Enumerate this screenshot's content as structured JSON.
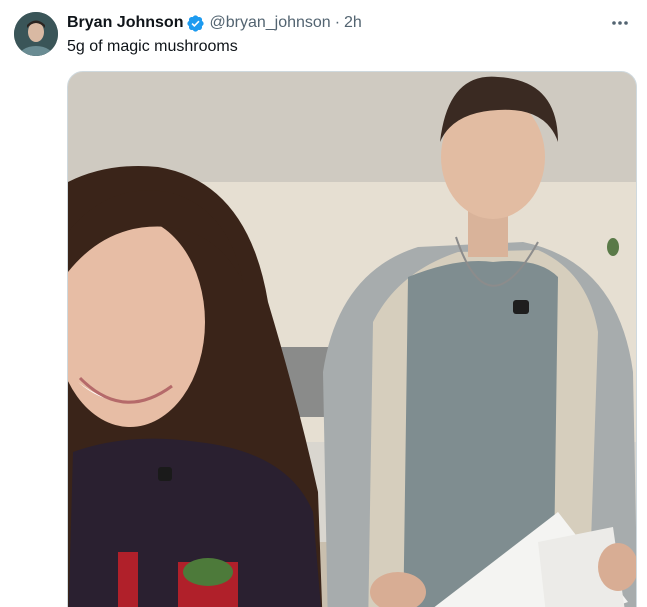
{
  "tweet": {
    "author": {
      "display_name": "Bryan Johnson",
      "verified": true,
      "handle": "@bryan_johnson",
      "avatar_icon": "avatar-photo"
    },
    "separator": "·",
    "timestamp": "2h",
    "text": "5g of magic mushrooms",
    "media": {
      "type": "video-still",
      "description_icon": "video-frame"
    }
  },
  "colors": {
    "verified_blue": "#1d9bf0",
    "secondary_text": "#536471",
    "primary_text": "#0f1419",
    "media_border": "#cfd9de"
  }
}
